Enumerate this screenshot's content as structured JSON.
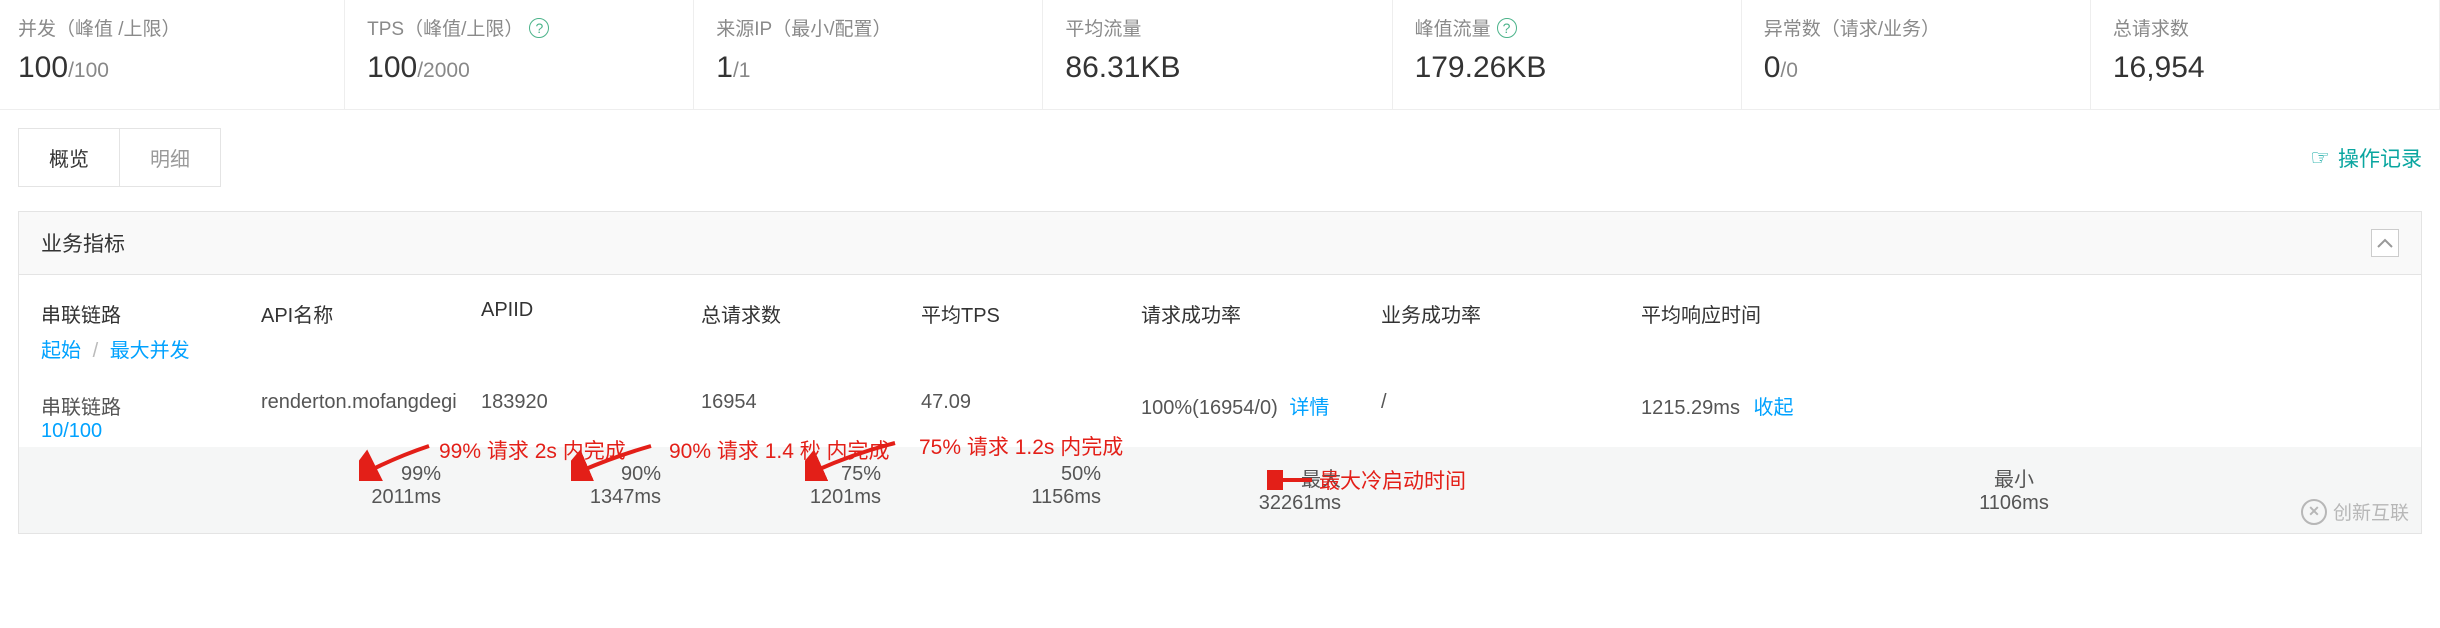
{
  "metrics": [
    {
      "label": "并发（峰值 /上限）",
      "value": "100",
      "denom": "/100",
      "help": false
    },
    {
      "label": "TPS（峰值/上限）",
      "value": "100",
      "denom": "/2000",
      "help": true
    },
    {
      "label": "来源IP（最小/配置）",
      "value": "1",
      "denom": "/1",
      "help": false
    },
    {
      "label": "平均流量",
      "value": "86.31KB",
      "denom": "",
      "help": false
    },
    {
      "label": "峰值流量",
      "value": "179.26KB",
      "denom": "",
      "help": true
    },
    {
      "label": "异常数（请求/业务）",
      "value": "0",
      "denom": "/0",
      "help": false
    },
    {
      "label": "总请求数",
      "value": "16,954",
      "denom": "",
      "help": false
    }
  ],
  "tabs": {
    "overview": "概览",
    "detail": "明细"
  },
  "opLog": "操作记录",
  "panel": {
    "title": "业务指标"
  },
  "columns": {
    "c0_main": "串联链路",
    "c0_sub_a": "起始",
    "c0_sub_b": "最大并发",
    "c1": "API名称",
    "c2": "APIID",
    "c3": "总请求数",
    "c4": "平均TPS",
    "c5": "请求成功率",
    "c6": "业务成功率",
    "c7": "平均响应时间"
  },
  "row": {
    "link_main": "串联链路",
    "link_sub": "10/100",
    "api": "renderton.mofangdegi",
    "apiid": "183920",
    "total": "16954",
    "tps": "47.09",
    "success_pct": "100%",
    "success_detail": "(16954/0)",
    "detail_label": "详情",
    "biz": "/",
    "avg_resp": "1215.29ms",
    "collapse": "收起"
  },
  "row2": {
    "p99": "99%",
    "p99_ms": "2011ms",
    "p90": "90%",
    "p90_ms": "1347ms",
    "p75": "75%",
    "p75_ms": "1201ms",
    "p50": "50%",
    "p50_ms": "1156ms",
    "max_label": "最大",
    "max_ms": "32261ms",
    "min_label": "最小",
    "min_ms": "1106ms"
  },
  "annotations": {
    "a99": "99% 请求 2s 内完成",
    "a90": "90% 请求 1.4 秒 内完成",
    "a75": "75% 请求 1.2s 内完成",
    "cold": "最大冷启动时间"
  },
  "watermark": "创新互联"
}
